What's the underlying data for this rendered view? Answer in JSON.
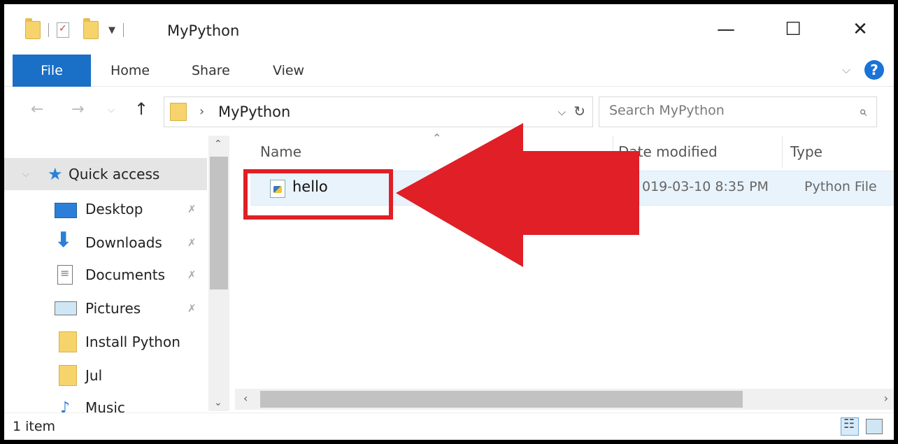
{
  "window": {
    "title": "MyPython",
    "minimize": "—",
    "maximize": "☐",
    "close": "✕"
  },
  "ribbon": {
    "tabs": {
      "file": "File",
      "home": "Home",
      "share": "Share",
      "view": "View"
    },
    "expand": "⌵",
    "help": "?"
  },
  "address": {
    "path": "MyPython",
    "separator": "›",
    "dropdown": "⌵",
    "refresh": "↻"
  },
  "nav_buttons": {
    "back": "←",
    "forward": "→",
    "recent": "⌵",
    "up": "↑"
  },
  "search": {
    "placeholder": "Search MyPython",
    "icon": "⌕"
  },
  "navpane": {
    "quick_access": "Quick access",
    "items": [
      {
        "label": "Desktop",
        "pin": "✗"
      },
      {
        "label": "Downloads",
        "pin": "✗"
      },
      {
        "label": "Documents",
        "pin": "✗"
      },
      {
        "label": "Pictures",
        "pin": "✗"
      },
      {
        "label": "Install Python"
      },
      {
        "label": "Jul"
      },
      {
        "label": "Music"
      }
    ],
    "scroll_up": "⌃",
    "scroll_down": "⌄"
  },
  "columns": {
    "name": "Name",
    "date": "Date modified",
    "type": "Type",
    "sort": "⌃"
  },
  "files": [
    {
      "name": "hello",
      "date": "019-03-10 8:35 PM",
      "type": "Python File"
    }
  ],
  "hscroll": {
    "left": "‹",
    "right": "›"
  },
  "status": {
    "count": "1 item"
  },
  "annotation_color": "#e01f26"
}
